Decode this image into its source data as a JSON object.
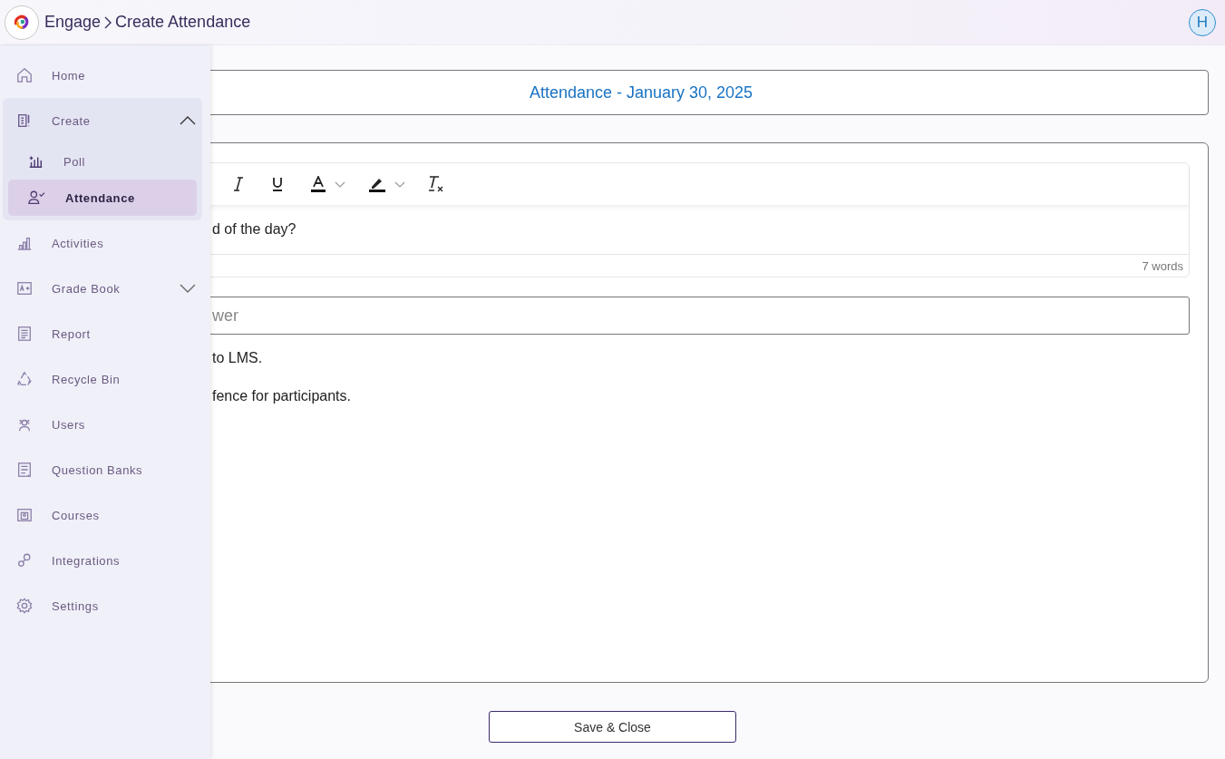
{
  "header": {
    "app": "Engage",
    "page": "Create Attendance",
    "avatar": "H"
  },
  "sidebar": {
    "items": [
      {
        "label": "Home",
        "kind": "link",
        "selected": false
      },
      {
        "label": "Create",
        "kind": "group",
        "expanded": true,
        "selected": false,
        "children": [
          {
            "label": "Poll",
            "selected": false
          },
          {
            "label": "Attendance",
            "selected": true
          }
        ]
      },
      {
        "label": "Activities",
        "kind": "link",
        "selected": false
      },
      {
        "label": "Grade Book",
        "kind": "group",
        "expanded": false,
        "selected": false
      },
      {
        "label": "Report",
        "kind": "link",
        "selected": false
      },
      {
        "label": "Recycle Bin",
        "kind": "link",
        "selected": false
      },
      {
        "label": "Users",
        "kind": "link",
        "selected": false
      },
      {
        "label": "Question Banks",
        "kind": "link",
        "selected": false
      },
      {
        "label": "Courses",
        "kind": "link",
        "selected": false
      },
      {
        "label": "Integrations",
        "kind": "link",
        "selected": false
      },
      {
        "label": "Settings",
        "kind": "link",
        "selected": false
      }
    ]
  },
  "title": "Attendance - January 30, 2025",
  "editor": {
    "text": "d of the day?",
    "word_count": "7 words"
  },
  "answer": {
    "placeholder": "wer"
  },
  "notes": [
    "to LMS.",
    "fence for participants."
  ],
  "save_button": "Save & Close"
}
